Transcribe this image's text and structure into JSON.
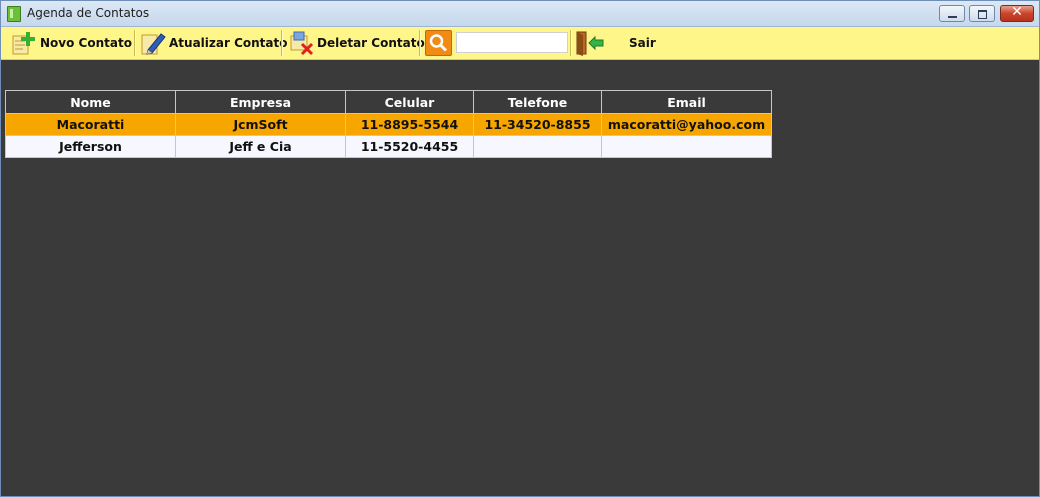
{
  "window": {
    "title": "Agenda de Contatos"
  },
  "toolbar": {
    "novo_label": "Novo Contato",
    "atualizar_label": "Atualizar Contato",
    "deletar_label": "Deletar Contato",
    "search_value": "",
    "sair_label": "Sair"
  },
  "grid": {
    "headers": [
      "Nome",
      "Empresa",
      "Celular",
      "Telefone",
      "Email"
    ],
    "rows": [
      {
        "nome": "Macoratti",
        "empresa": "JcmSoft",
        "celular": "11-8895-5544",
        "telefone": "11-34520-8855",
        "email": "macoratti@yahoo.com"
      },
      {
        "nome": "Jefferson",
        "empresa": "Jeff e Cia",
        "celular": "11-5520-4455",
        "telefone": "",
        "email": ""
      }
    ]
  },
  "colors": {
    "toolbar_bg": "#fff68a",
    "selected_row": "#f7a600",
    "background": "#3a3a3a",
    "header_bg": "#3a3a3a"
  },
  "icons": {
    "app": "address-book-icon",
    "novo": "add-contact-icon",
    "atualizar": "edit-pencil-icon",
    "deletar": "delete-contact-icon",
    "search": "magnifier-icon",
    "sair": "exit-door-icon"
  }
}
